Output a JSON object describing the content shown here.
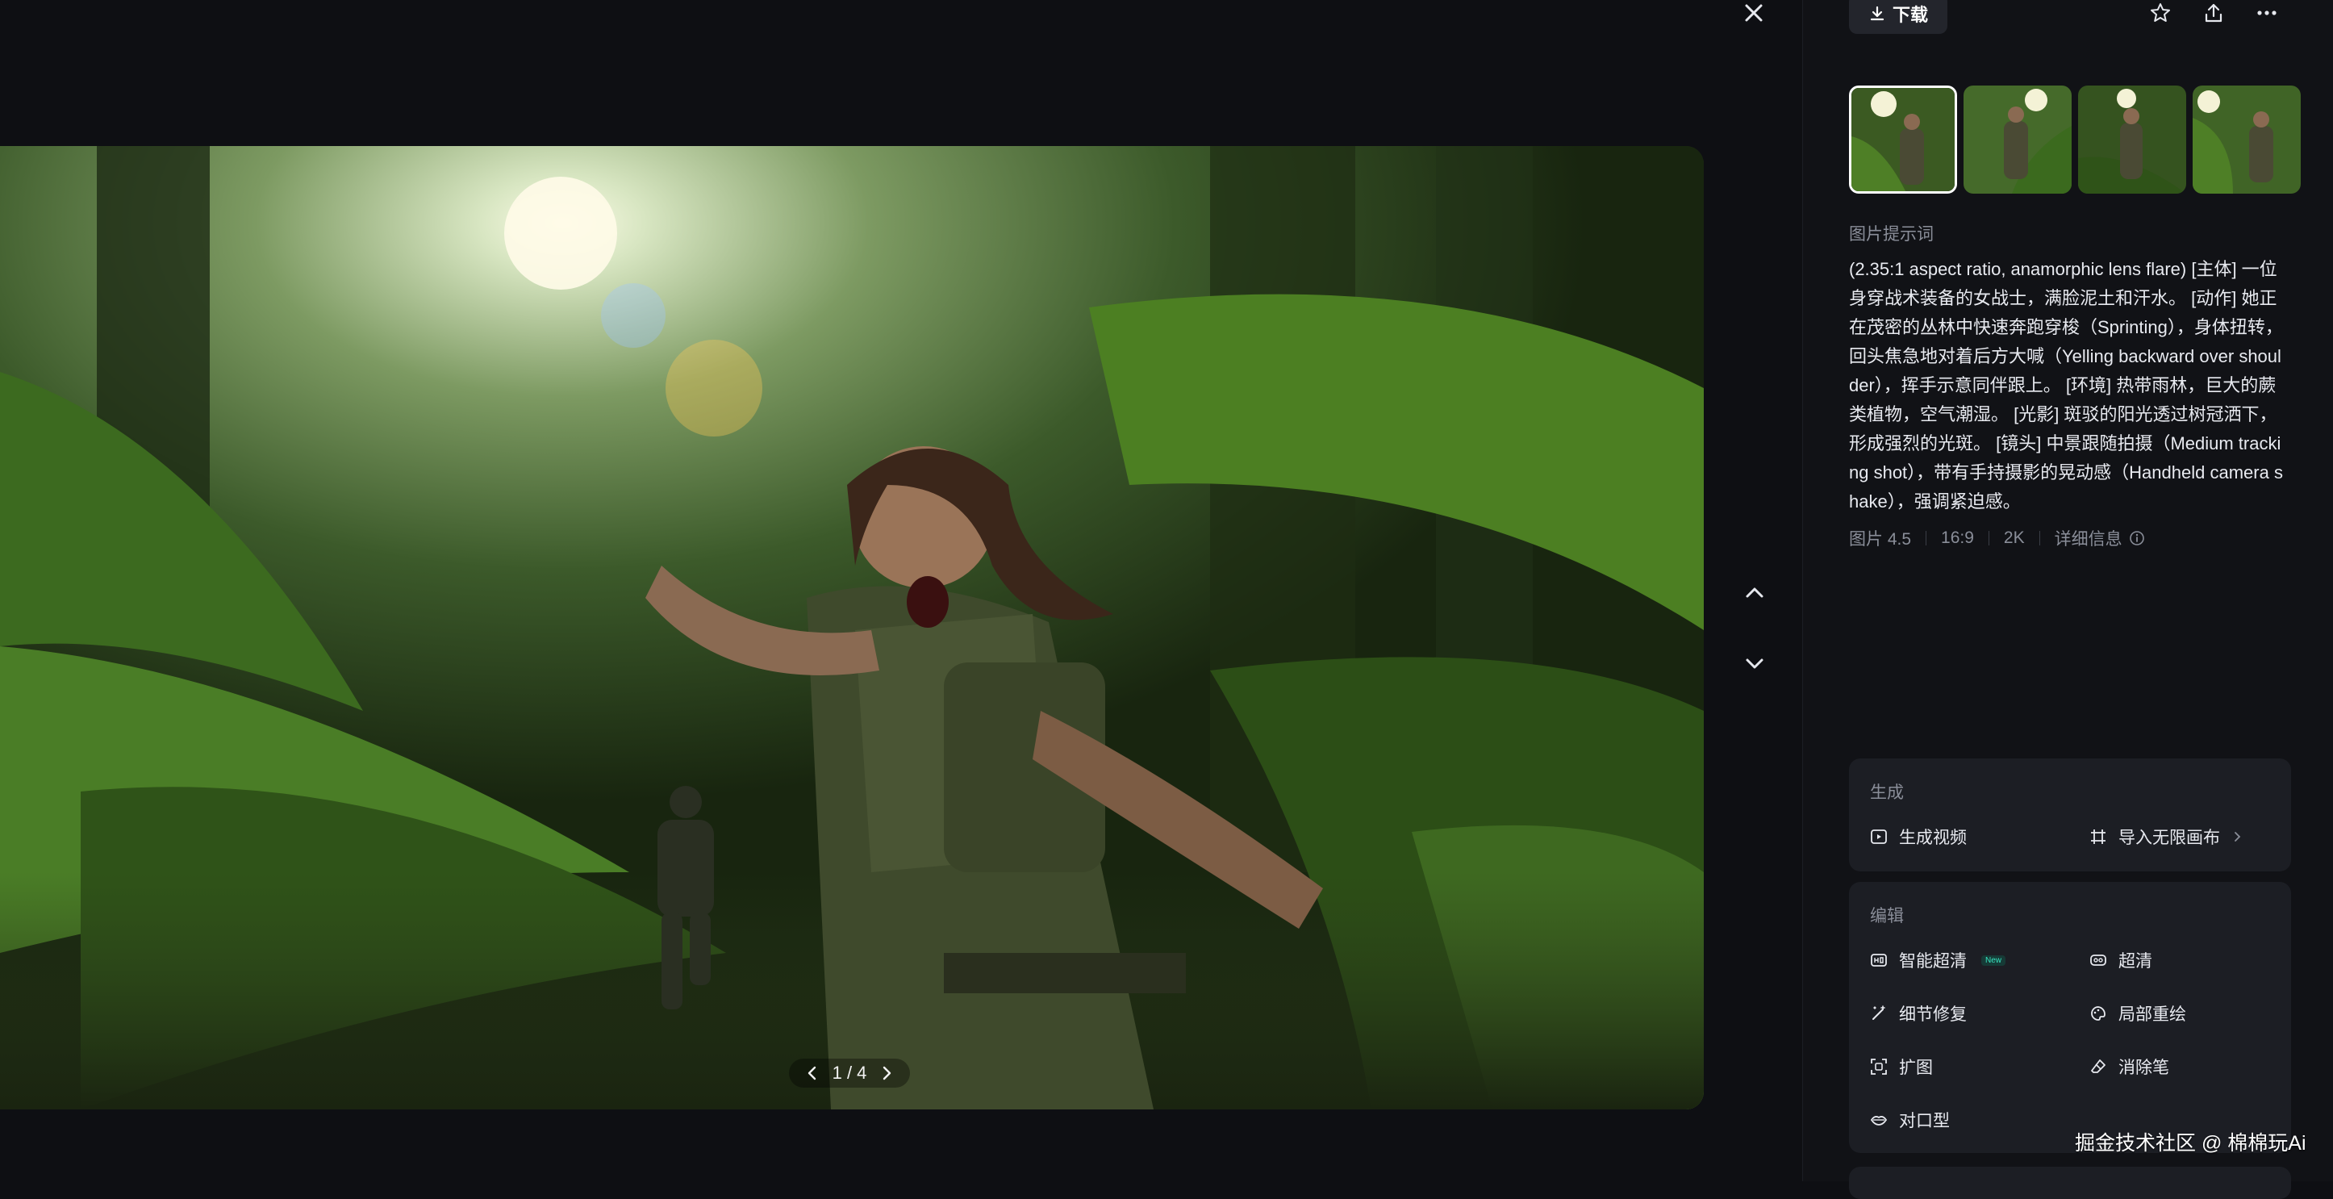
{
  "viewer": {
    "pager_text": "1 / 4"
  },
  "toolbar": {
    "download_label": "下载"
  },
  "thumbnails": [
    {
      "label": "",
      "active": true
    },
    {
      "label": "",
      "active": false
    },
    {
      "label": "",
      "active": false
    },
    {
      "label": "",
      "active": false
    }
  ],
  "prompt": {
    "title": "图片提示词",
    "text": "(2.35:1 aspect ratio, anamorphic lens flare) [主体] 一位身穿战术装备的女战士，满脸泥土和汗水。 [动作] 她正在茂密的丛林中快速奔跑穿梭（Sprinting），身体扭转，回头焦急地对着后方大喊（Yelling backward over shoulder），挥手示意同伴跟上。 [环境] 热带雨林，巨大的蕨类植物，空气潮湿。 [光影] 斑驳的阳光透过树冠洒下，形成强烈的光斑。 [镜头] 中景跟随拍摄（Medium tracking shot），带有手持摄影的晃动感（Handheld camera shake），强调紧迫感。"
  },
  "meta": {
    "model": "图片 4.5",
    "ratio": "16:9",
    "resolution": "2K",
    "details": "详细信息"
  },
  "generate": {
    "title": "生成",
    "video": "生成视频",
    "canvas": "导入无限画布"
  },
  "edit": {
    "title": "编辑",
    "smart_hd": "智能超清",
    "new_badge": "New",
    "hd": "超清",
    "detail_fix": "细节修复",
    "local_redraw": "局部重绘",
    "expand": "扩图",
    "eraser": "消除笔",
    "lip_sync": "对口型"
  },
  "watermark": "掘金技术社区 @ 棉棉玩Ai"
}
